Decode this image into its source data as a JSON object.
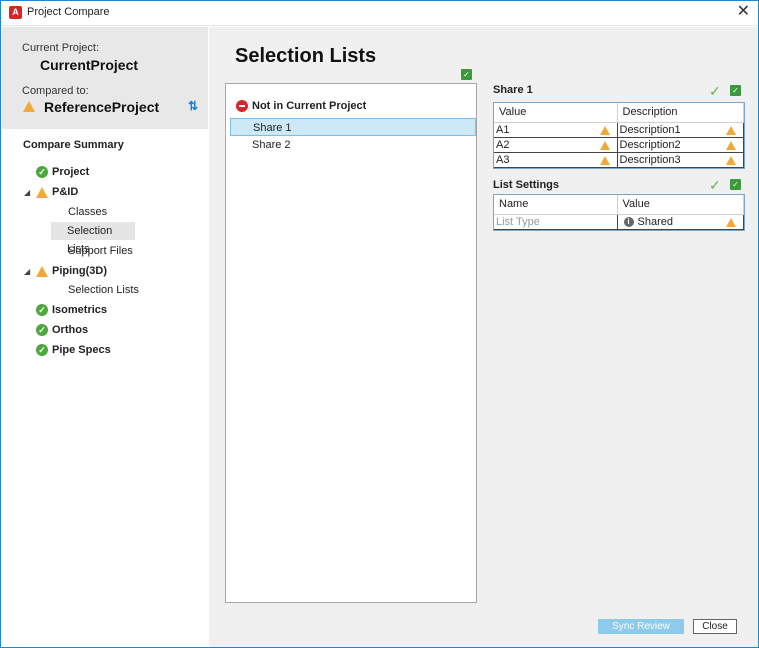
{
  "window": {
    "title": "Project Compare",
    "app_icon": "A"
  },
  "sidebar": {
    "current_label": "Current Project:",
    "current_name": "CurrentProject",
    "compared_label": "Compared to:",
    "compared_name": "ReferenceProject",
    "summary_title": "Compare Summary",
    "tree": [
      {
        "label": "Project",
        "status": "ok"
      },
      {
        "label": "P&ID",
        "status": "warn"
      },
      {
        "label": "Classes"
      },
      {
        "label": "Selection Lists",
        "selected": true
      },
      {
        "label": "Support Files"
      },
      {
        "label": "Piping(3D)",
        "status": "warn"
      },
      {
        "label": "Selection Lists"
      },
      {
        "label": "Isometrics",
        "status": "ok"
      },
      {
        "label": "Orthos",
        "status": "ok"
      },
      {
        "label": "Pipe Specs",
        "status": "ok"
      }
    ]
  },
  "main": {
    "title": "Selection Lists",
    "list_header": "Not in Current Project",
    "list_items": [
      "Share 1",
      "Share 2"
    ]
  },
  "share_panel": {
    "title": "Share 1",
    "columns": [
      "Value",
      "Description"
    ],
    "rows": [
      {
        "value": "A1",
        "description": "Description1"
      },
      {
        "value": "A2",
        "description": "Description2"
      },
      {
        "value": "A3",
        "description": "Description3"
      }
    ]
  },
  "list_settings": {
    "title": "List Settings",
    "columns": [
      "Name",
      "Value"
    ],
    "rows": [
      {
        "name": "List Type",
        "value": "Shared"
      }
    ]
  },
  "buttons": {
    "sync": "Sync Review",
    "close": "Close"
  },
  "colors": {
    "ok": "#4fa83d",
    "warn": "#f2a93b",
    "error": "#d7262b",
    "selection": "#cde8f7",
    "accent": "#1a7fd4"
  }
}
